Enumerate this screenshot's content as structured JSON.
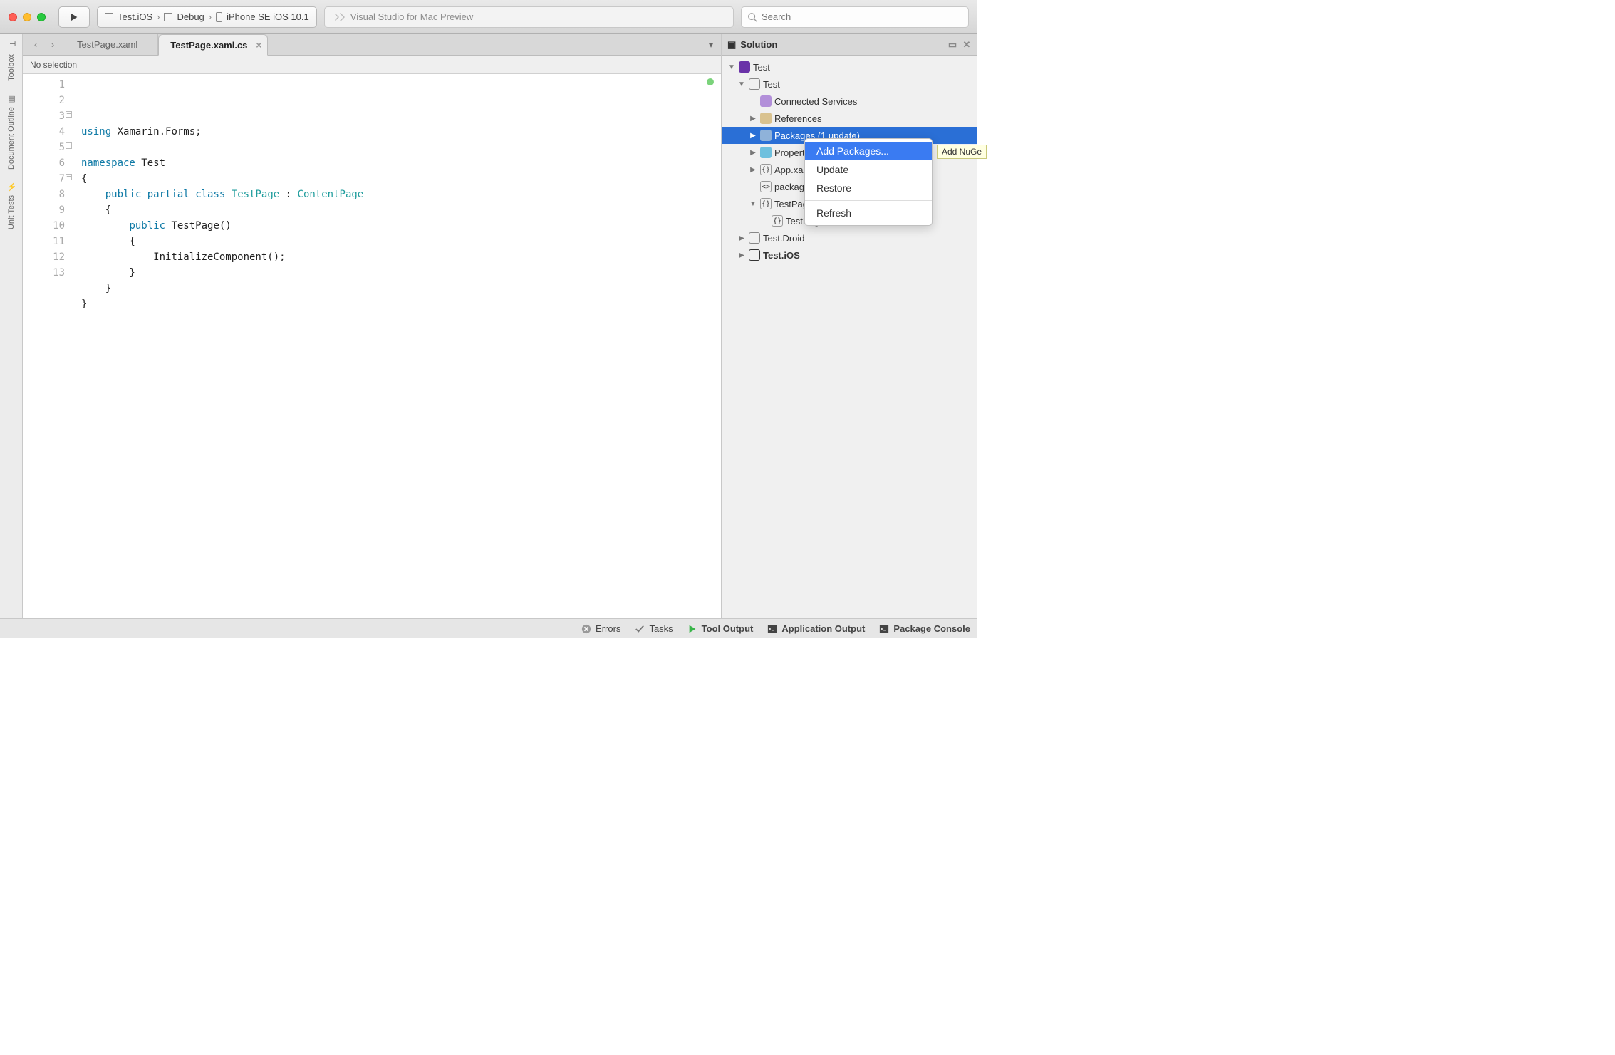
{
  "titlebar": {
    "breadcrumb": {
      "project": "Test.iOS",
      "config": "Debug",
      "target": "iPhone SE iOS 10.1"
    },
    "center_text": "Visual Studio for Mac Preview",
    "search_placeholder": "Search"
  },
  "left_gutter": {
    "toolbox": "Toolbox",
    "outline": "Document Outline",
    "tests": "Unit Tests"
  },
  "tabs": [
    {
      "label": "TestPage.xaml",
      "active": false
    },
    {
      "label": "TestPage.xaml.cs",
      "active": true
    }
  ],
  "subbar": {
    "text": "No selection"
  },
  "code": {
    "lines": [
      {
        "n": 1,
        "tokens": [
          [
            "k",
            "using"
          ],
          [
            "",
            " Xamarin.Forms;"
          ]
        ]
      },
      {
        "n": 2,
        "tokens": [
          [
            "",
            ""
          ]
        ]
      },
      {
        "n": 3,
        "tokens": [
          [
            "k",
            "namespace"
          ],
          [
            "",
            " Test"
          ]
        ],
        "fold": true
      },
      {
        "n": 4,
        "tokens": [
          [
            "",
            "{"
          ]
        ]
      },
      {
        "n": 5,
        "tokens": [
          [
            "",
            "    "
          ],
          [
            "k",
            "public"
          ],
          [
            "",
            " "
          ],
          [
            "k",
            "partial"
          ],
          [
            "",
            " "
          ],
          [
            "k",
            "class"
          ],
          [
            "",
            " "
          ],
          [
            "t",
            "TestPage"
          ],
          [
            "",
            " : "
          ],
          [
            "t",
            "ContentPage"
          ]
        ],
        "fold": true
      },
      {
        "n": 6,
        "tokens": [
          [
            "",
            "    {"
          ]
        ]
      },
      {
        "n": 7,
        "tokens": [
          [
            "",
            "        "
          ],
          [
            "k",
            "public"
          ],
          [
            "",
            " TestPage()"
          ]
        ],
        "fold": true
      },
      {
        "n": 8,
        "tokens": [
          [
            "",
            "        {"
          ]
        ]
      },
      {
        "n": 9,
        "tokens": [
          [
            "",
            "            InitializeComponent();"
          ]
        ]
      },
      {
        "n": 10,
        "tokens": [
          [
            "",
            "        }"
          ]
        ]
      },
      {
        "n": 11,
        "tokens": [
          [
            "",
            "    }"
          ]
        ]
      },
      {
        "n": 12,
        "tokens": [
          [
            "",
            "}"
          ]
        ]
      },
      {
        "n": 13,
        "tokens": [
          [
            "",
            ""
          ]
        ]
      }
    ]
  },
  "solution": {
    "title": "Solution",
    "tree": [
      {
        "d": 1,
        "arrow": "down",
        "icon": "sln",
        "label": "Test"
      },
      {
        "d": 2,
        "arrow": "down",
        "icon": "proj",
        "label": "Test"
      },
      {
        "d": 3,
        "arrow": "",
        "icon": "svc",
        "label": "Connected Services"
      },
      {
        "d": 3,
        "arrow": "right",
        "icon": "ref",
        "label": "References"
      },
      {
        "d": 3,
        "arrow": "right",
        "icon": "pkg",
        "label": "Packages (1 update)",
        "selected": true
      },
      {
        "d": 3,
        "arrow": "right",
        "icon": "fold",
        "label": "Properties"
      },
      {
        "d": 3,
        "arrow": "right",
        "icon": "cs",
        "label": "App.xaml.cs"
      },
      {
        "d": 3,
        "arrow": "",
        "icon": "xml",
        "label": "packages.config"
      },
      {
        "d": 3,
        "arrow": "down",
        "icon": "cs",
        "label": "TestPage.xaml"
      },
      {
        "d": 4,
        "arrow": "",
        "icon": "cs",
        "label": "TestPage.xaml.cs"
      },
      {
        "d": 2,
        "arrow": "right",
        "icon": "proj",
        "label": "Test.Droid"
      },
      {
        "d": 2,
        "arrow": "right",
        "icon": "projb",
        "label": "Test.iOS",
        "bold": true
      }
    ]
  },
  "context_menu": {
    "items": [
      "Add Packages...",
      "Update",
      "Restore",
      "Refresh"
    ],
    "highlighted": 0
  },
  "tooltip": "Add NuGe",
  "bottombar": {
    "errors": "Errors",
    "tasks": "Tasks",
    "tool_output": "Tool Output",
    "app_output": "Application Output",
    "pkg_console": "Package Console"
  }
}
